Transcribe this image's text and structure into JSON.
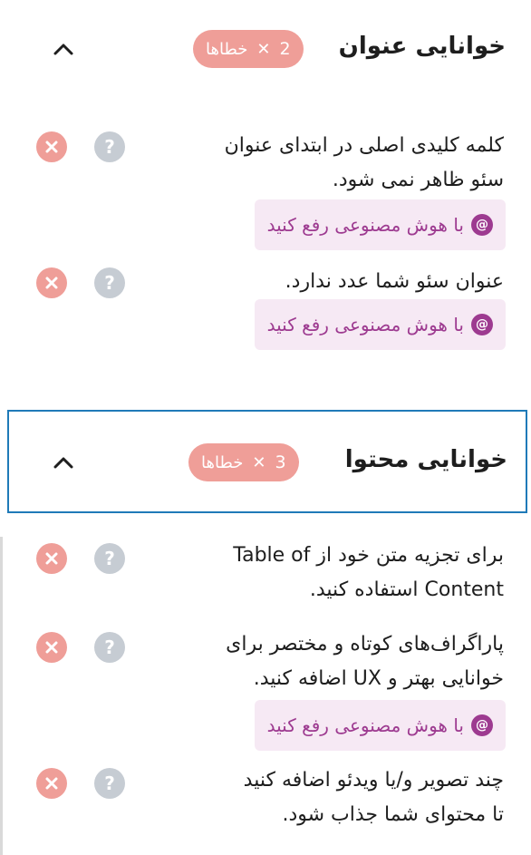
{
  "sections": [
    {
      "title": "خوانایی عنوان",
      "badge_count": "2",
      "badge_label": "خطاها",
      "items": [
        {
          "lines": [
            "کلمه کلیدی اصلی در ابتدای عنوان",
            "سئو ظاهر نمی شود."
          ],
          "ai_fix": "با هوش مصنوعی رفع کنید"
        },
        {
          "lines": [
            "عنوان سئو شما عدد ندارد."
          ],
          "ai_fix": "با هوش مصنوعی رفع کنید"
        }
      ]
    },
    {
      "title": "خوانایی محتوا",
      "badge_count": "3",
      "badge_label": "خطاها",
      "items": [
        {
          "lines": [
            "برای تجزیه متن خود از Table of",
            "Content استفاده کنید."
          ],
          "ai_fix": ""
        },
        {
          "lines": [
            "پاراگراف‌های کوتاه و مختصر برای",
            "خوانایی بهتر و UX اضافه کنید."
          ],
          "ai_fix": "با هوش مصنوعی رفع کنید"
        },
        {
          "lines": [
            "چند تصویر و/یا ویدئو اضافه کنید",
            "تا محتوای شما جذاب شود."
          ],
          "ai_fix": ""
        }
      ]
    }
  ],
  "icons": {
    "error": "close-circle-icon",
    "help": "question-circle-icon",
    "expand": "chevron-up-icon",
    "ai": "ai-sparkle-icon"
  },
  "colors": {
    "error_badge": "#ef9e98",
    "help_icon": "#c6ccd3",
    "ai_text": "#9d3a90",
    "ai_bg": "#f6e9f4",
    "focus_border": "#1f7ab8"
  }
}
